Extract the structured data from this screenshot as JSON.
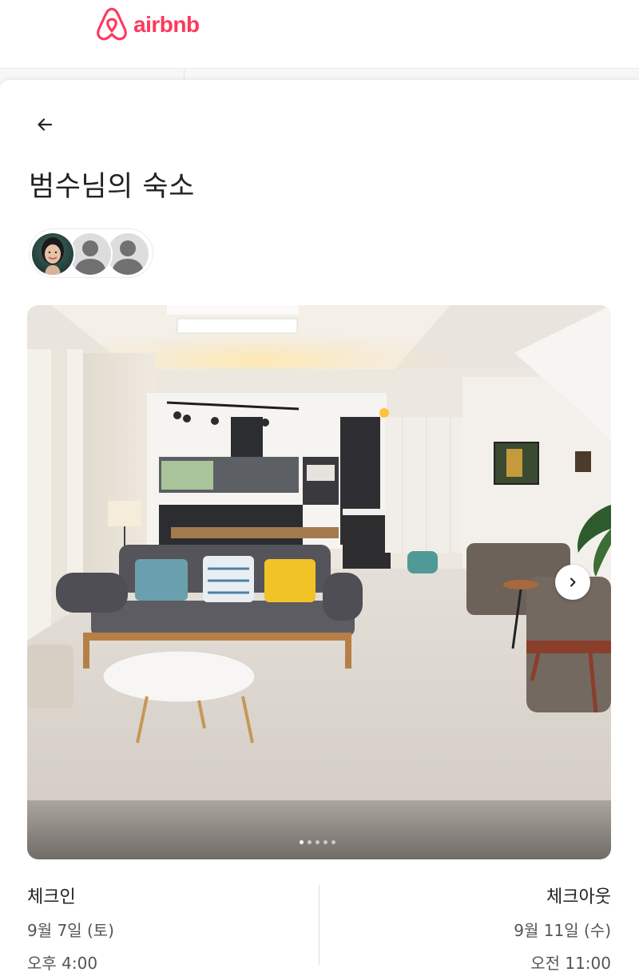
{
  "brand": {
    "name": "airbnb",
    "color": "#ff385c"
  },
  "header": {
    "back_icon": "arrow-left-icon"
  },
  "listing": {
    "title": "범수님의 숙소",
    "hosts": [
      "host-photo",
      "default-avatar",
      "default-avatar"
    ]
  },
  "gallery": {
    "current_index": 1,
    "total": 5,
    "next_icon": "chevron-right-icon"
  },
  "checkin": {
    "label": "체크인",
    "date": "9월 7일 (토)",
    "time": "오후 4:00"
  },
  "checkout": {
    "label": "체크아웃",
    "date": "9월 11일 (수)",
    "time": "오전 11:00"
  }
}
